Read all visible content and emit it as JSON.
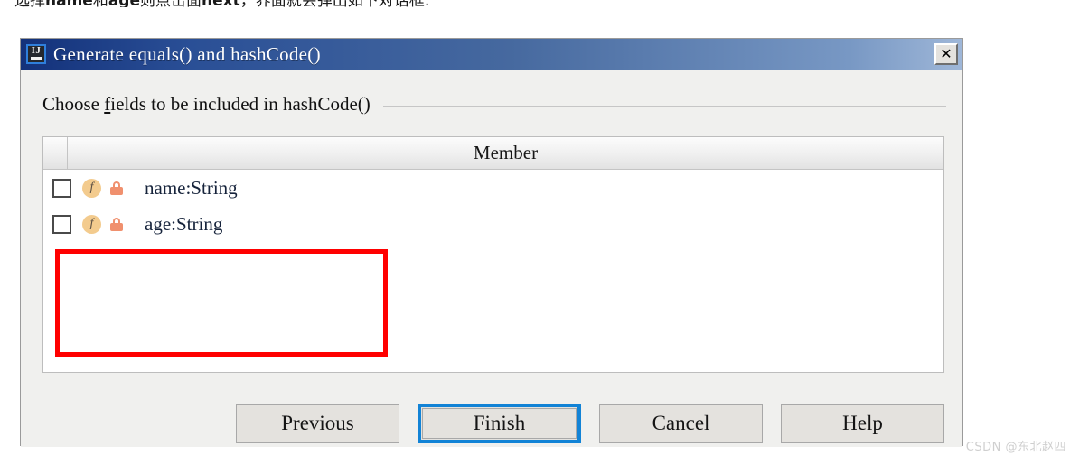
{
  "page_text": {
    "prefix": "选择",
    "bold1": "name",
    "middle": "和",
    "bold2": "age",
    "suffix": "则点击面",
    "bold3": "next",
    "tail": "，界面就会弹出如下对话框:"
  },
  "dialog": {
    "title": "Generate equals() and hashCode()",
    "icon": "intellij-idea-icon",
    "icon_letters": "IJ",
    "close_label": "✕",
    "section": {
      "label_before": "Choose ",
      "label_mnemonic": "f",
      "label_after": "ields to be included in hashCode()"
    },
    "table": {
      "columns": [
        "",
        "Member"
      ],
      "rows": [
        {
          "checked": false,
          "field_icon": "f",
          "visibility_icon": "lock-icon",
          "member": "name:String"
        },
        {
          "checked": false,
          "field_icon": "f",
          "visibility_icon": "lock-icon",
          "member": "age:String"
        }
      ]
    },
    "buttons": [
      {
        "label": "Previous",
        "focused": false
      },
      {
        "label": "Finish",
        "focused": true
      },
      {
        "label": "Cancel",
        "focused": false
      },
      {
        "label": "Help",
        "focused": false
      }
    ]
  },
  "annotation": {
    "color": "#ff0000",
    "shape": "rectangle"
  },
  "watermark": "CSDN @东北赵四",
  "colors": {
    "titlebar_start": "#13317a",
    "titlebar_end": "#9fb7d8",
    "focus_blue": "#1283d6",
    "field_icon_bg": "#f3cb8e",
    "lock_icon": "#f0906e",
    "dialog_bg": "#f0f0ee",
    "annotation_red": "#ff0000"
  }
}
